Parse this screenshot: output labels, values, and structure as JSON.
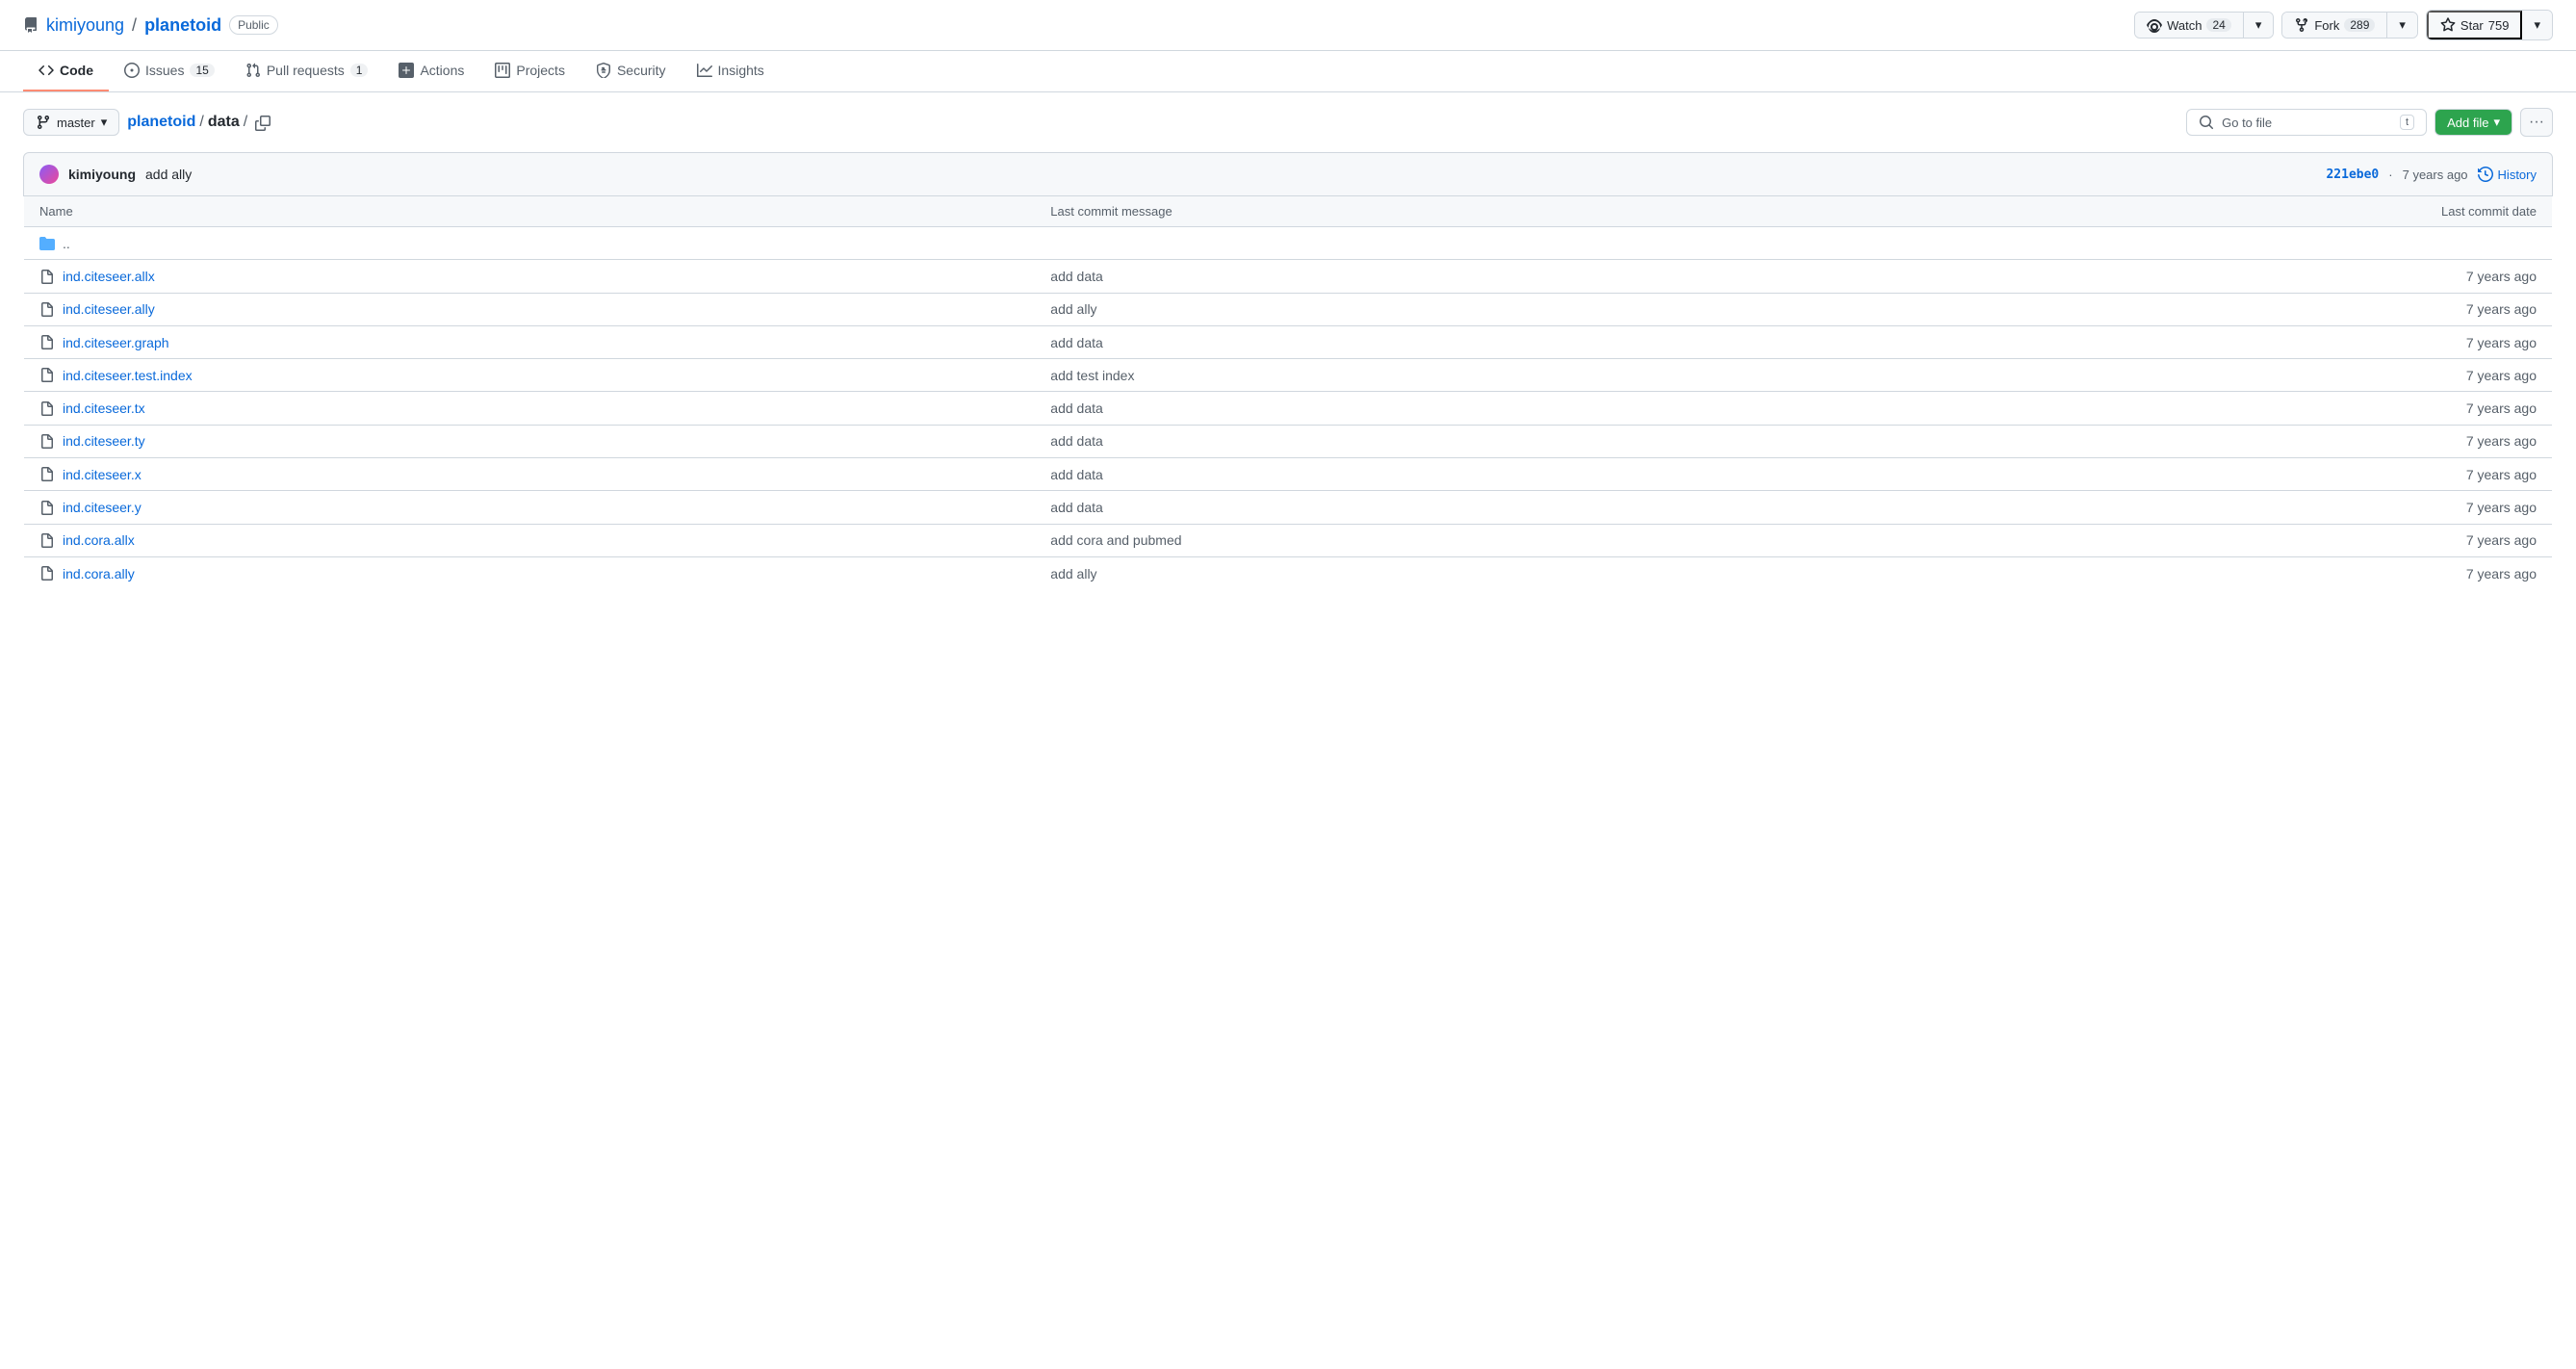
{
  "header": {
    "owner": "kimiyoung",
    "separator": "/",
    "repo": "planetoid",
    "visibility": "Public",
    "watch_label": "Watch",
    "watch_count": "24",
    "fork_label": "Fork",
    "fork_count": "289",
    "star_label": "Star",
    "star_count": "759"
  },
  "nav": {
    "tabs": [
      {
        "id": "code",
        "label": "Code",
        "badge": null,
        "active": true
      },
      {
        "id": "issues",
        "label": "Issues",
        "badge": "15",
        "active": false
      },
      {
        "id": "pull-requests",
        "label": "Pull requests",
        "badge": "1",
        "active": false
      },
      {
        "id": "actions",
        "label": "Actions",
        "badge": null,
        "active": false
      },
      {
        "id": "projects",
        "label": "Projects",
        "badge": null,
        "active": false
      },
      {
        "id": "security",
        "label": "Security",
        "badge": null,
        "active": false
      },
      {
        "id": "insights",
        "label": "Insights",
        "badge": null,
        "active": false
      }
    ]
  },
  "toolbar": {
    "branch": "master",
    "breadcrumb_repo": "planetoid",
    "breadcrumb_folder": "data",
    "search_placeholder": "Go to file",
    "search_shortcut": "t",
    "add_file_label": "Add file",
    "more_label": "···"
  },
  "commit_bar": {
    "avatar_alt": "kimiyoung avatar",
    "author": "kimiyoung",
    "message": "add ally",
    "hash": "221ebe0",
    "time": "7 years ago",
    "history_label": "History"
  },
  "table": {
    "col_name": "Name",
    "col_commit": "Last commit message",
    "col_date": "Last commit date",
    "rows": [
      {
        "type": "parent",
        "name": "..",
        "commit": "",
        "date": ""
      },
      {
        "type": "file",
        "name": "ind.citeseer.allx",
        "commit": "add data",
        "date": "7 years ago"
      },
      {
        "type": "file",
        "name": "ind.citeseer.ally",
        "commit": "add ally",
        "date": "7 years ago"
      },
      {
        "type": "file",
        "name": "ind.citeseer.graph",
        "commit": "add data",
        "date": "7 years ago"
      },
      {
        "type": "file",
        "name": "ind.citeseer.test.index",
        "commit": "add test index",
        "date": "7 years ago"
      },
      {
        "type": "file",
        "name": "ind.citeseer.tx",
        "commit": "add data",
        "date": "7 years ago"
      },
      {
        "type": "file",
        "name": "ind.citeseer.ty",
        "commit": "add data",
        "date": "7 years ago"
      },
      {
        "type": "file",
        "name": "ind.citeseer.x",
        "commit": "add data",
        "date": "7 years ago"
      },
      {
        "type": "file",
        "name": "ind.citeseer.y",
        "commit": "add data",
        "date": "7 years ago"
      },
      {
        "type": "file",
        "name": "ind.cora.allx",
        "commit": "add cora and pubmed",
        "date": "7 years ago"
      },
      {
        "type": "file",
        "name": "ind.cora.ally",
        "commit": "add ally",
        "date": "7 years ago"
      }
    ]
  }
}
